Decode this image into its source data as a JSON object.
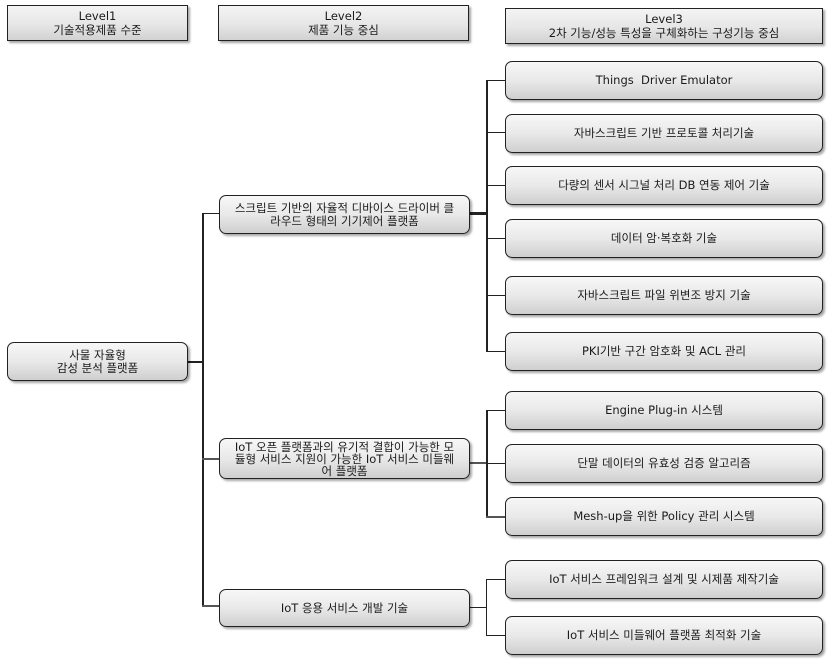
{
  "headers": [
    {
      "title": "Level1",
      "subtitle": "기술적용제품 수준"
    },
    {
      "title": "Level2",
      "subtitle": "제품 기능 중심"
    },
    {
      "title": "Level3",
      "subtitle": "2차 기능/성능 특성을 구체화하는 구성기능 중심"
    }
  ],
  "root": {
    "label": "사물 자율형\n감성 분석 플랫폼"
  },
  "level2": [
    {
      "label": "스크립트 기반의 자율적 디바이스 드라이버 클라우드 형태의 기기제어 플랫폼"
    },
    {
      "label": "IoT 오픈 플랫폼과의 유기적 결합이 가능한 모듈형 서비스 지원이 가능한 IoT 서비스 미들웨어 플랫폼"
    },
    {
      "label": "IoT 응용 서비스 개발 기술"
    }
  ],
  "level3": [
    {
      "label": "Things  Driver Emulator",
      "parent": 0
    },
    {
      "label": "자바스크립트 기반 프로토콜 처리기술",
      "parent": 0
    },
    {
      "label": "다량의 센서 시그널 처리 DB 연동 제어 기술",
      "parent": 0
    },
    {
      "label": "데이터 암·복호화 기술",
      "parent": 0
    },
    {
      "label": "자바스크립트 파일 위변조 방지 기술",
      "parent": 0
    },
    {
      "label": "PKI기반 구간 암호화 및 ACL 관리",
      "parent": 0
    },
    {
      "label": "Engine Plug-in 시스템",
      "parent": 1
    },
    {
      "label": "단말 데이터의 유효성 검증 알고리즘",
      "parent": 1
    },
    {
      "label": "Mesh-up을 위한 Policy 관리 시스템",
      "parent": 1
    },
    {
      "label": "IoT 서비스 프레임워크 설계 및 시제품 제작기술",
      "parent": 2
    },
    {
      "label": "IoT 서비스 미들웨어 플랫폼 최적화 기술",
      "parent": 2
    }
  ]
}
